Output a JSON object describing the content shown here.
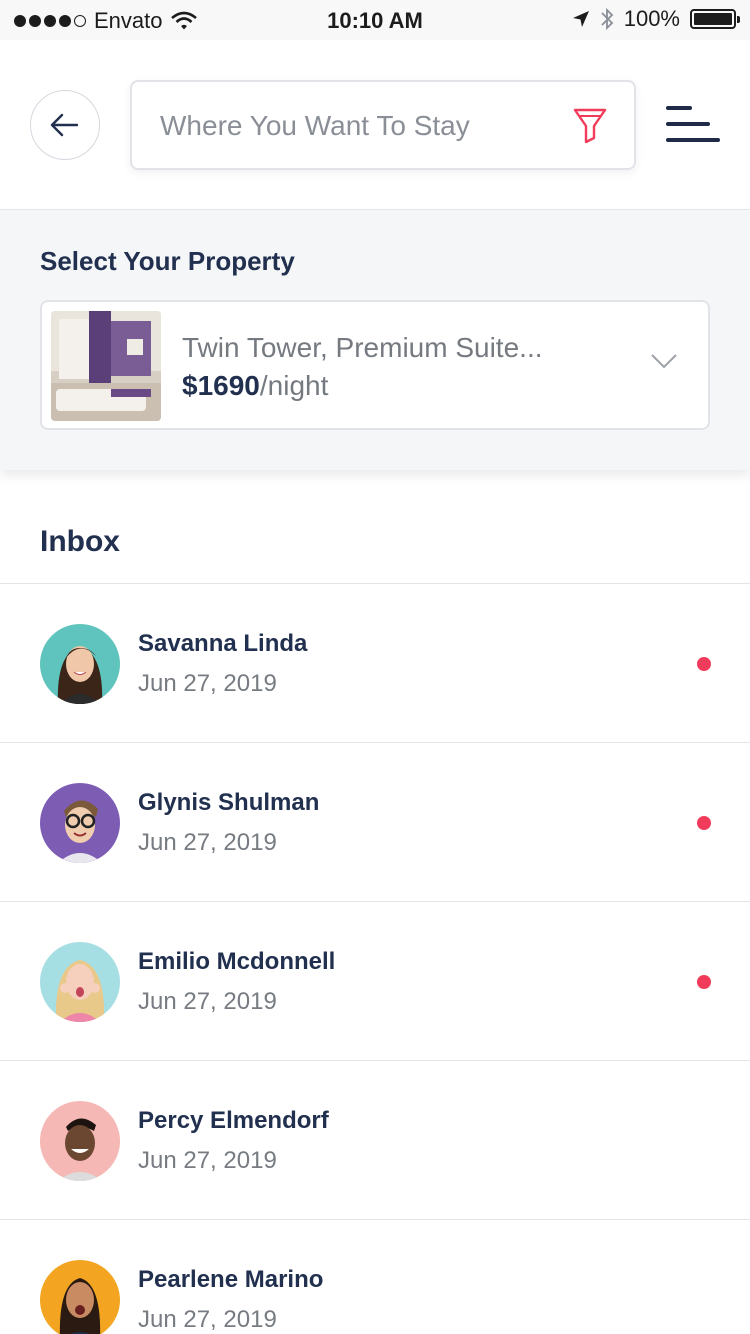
{
  "status_bar": {
    "carrier": "Envato",
    "time": "10:10 AM",
    "battery": "100%"
  },
  "header": {
    "search_placeholder": "Where You Want To Stay"
  },
  "property": {
    "section_title": "Select Your Property",
    "name": "Twin Tower, Premium Suite...",
    "price": "$1690",
    "unit": "/night"
  },
  "inbox": {
    "title": "Inbox",
    "items": [
      {
        "name": "Savanna Linda",
        "date": "Jun 27, 2019",
        "unread": true
      },
      {
        "name": "Glynis Shulman",
        "date": "Jun 27, 2019",
        "unread": true
      },
      {
        "name": "Emilio Mcdonnell",
        "date": "Jun 27, 2019",
        "unread": true
      },
      {
        "name": "Percy Elmendorf",
        "date": "Jun 27, 2019",
        "unread": false
      },
      {
        "name": "Pearlene Marino",
        "date": "Jun 27, 2019",
        "unread": false
      }
    ]
  },
  "colors": {
    "accent": "#f03c5a",
    "navy": "#22304f"
  }
}
